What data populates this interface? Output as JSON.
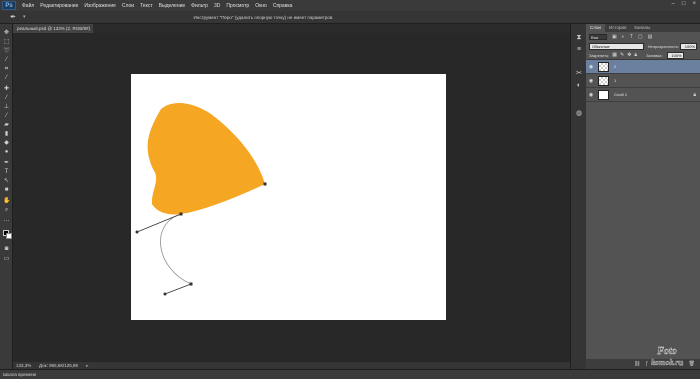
{
  "app": {
    "logo": "Ps",
    "menus": [
      "Файл",
      "Редактирование",
      "Изображение",
      "Слои",
      "Текст",
      "Выделение",
      "Фильтр",
      "3D",
      "Просмотр",
      "Окно",
      "Справка"
    ],
    "window_controls": [
      "–",
      "□",
      "×"
    ]
  },
  "options_bar": {
    "tool_icon": "pen-tool-icon",
    "tool_glyph": "✒",
    "arrow": "▾",
    "hint": "Инструмент \"Перо\" (удалить опорную точку) не имеет параметров."
  },
  "document": {
    "tab_title": "реальный.psd @ 133% (2, RGB/8#)",
    "tab_close": "×",
    "zoom": "133,3%",
    "doc_info": "Док: 965,6К/125,9К",
    "status_arrow": "▸"
  },
  "canvas": {
    "background": "#ffffff",
    "shape_color": "#f5a623"
  },
  "timeline": {
    "label": "Шкала времени"
  },
  "colors": {
    "foreground": "#000000",
    "background": "#ffffff",
    "selection": "#6b7f9f"
  },
  "panels": {
    "tabs": [
      "Слои",
      "История",
      "Каналы"
    ],
    "active_tab": "Слои",
    "filter_kind": "Вид",
    "blend_mode": "Обычные",
    "opacity_label": "Непрозрачность:",
    "opacity_value": "100%",
    "lock_label": "Закрепить:",
    "fill_label": "Заливка:",
    "fill_value": "100%",
    "layers": [
      {
        "name": "2",
        "selected": true,
        "thumb": "checker",
        "locked": false
      },
      {
        "name": "1",
        "selected": false,
        "thumb": "checker",
        "locked": false
      },
      {
        "name": "Слой 1",
        "selected": false,
        "thumb": "white",
        "locked": true
      }
    ],
    "footer_icons": [
      "link-icon",
      "fx-icon",
      "mask-icon",
      "adjustment-icon",
      "folder-icon",
      "new-layer-icon",
      "trash-icon"
    ]
  },
  "watermark": {
    "line1": "Foto",
    "line2": "komok.ru"
  }
}
